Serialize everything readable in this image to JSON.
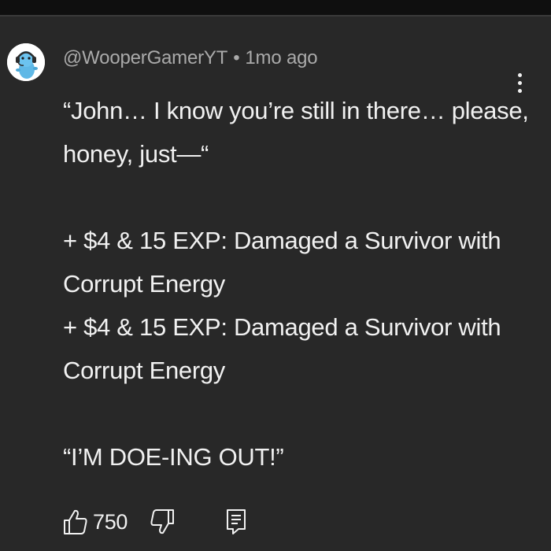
{
  "comment": {
    "author": "@WooperGamerYT",
    "separator": "•",
    "timestamp": "1mo ago",
    "lines": [
      "“John… I know you’re still in there… please,",
      "honey, just—“",
      "",
      "+ $4 & 15 EXP: Damaged a Survivor with",
      "Corrupt Energy",
      "+ $4 & 15 EXP: Damaged a Survivor with",
      "Corrupt Energy",
      "",
      "“I’M DOE-ING OUT!”"
    ],
    "likes": "750"
  },
  "icons": {
    "avatar": "wooper-avatar",
    "menu": "more-vertical-icon",
    "like": "thumbs-up-icon",
    "dislike": "thumbs-down-icon",
    "reply": "reply-comment-icon"
  },
  "colors": {
    "background": "#282828",
    "text_primary": "#f1f1f1",
    "text_secondary": "#aaaaaa"
  }
}
